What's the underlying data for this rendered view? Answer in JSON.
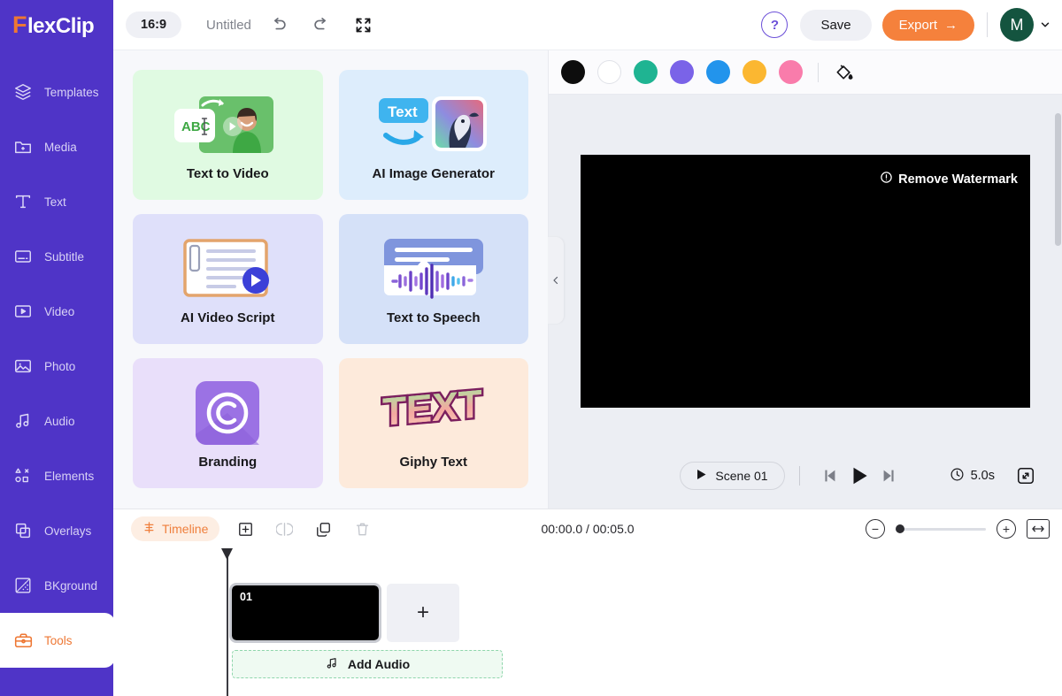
{
  "brand": {
    "prefix": "F",
    "rest": "lexClip"
  },
  "sidebar": {
    "items": [
      {
        "label": "Templates",
        "icon": "layers-icon",
        "active": false
      },
      {
        "label": "Media",
        "icon": "folder-plus-icon",
        "active": false
      },
      {
        "label": "Text",
        "icon": "text-t-icon",
        "active": false
      },
      {
        "label": "Subtitle",
        "icon": "subtitle-icon",
        "active": false
      },
      {
        "label": "Video",
        "icon": "video-play-icon",
        "active": false
      },
      {
        "label": "Photo",
        "icon": "photo-icon",
        "active": false
      },
      {
        "label": "Audio",
        "icon": "music-note-icon",
        "active": false
      },
      {
        "label": "Elements",
        "icon": "shapes-icon",
        "active": false
      },
      {
        "label": "Overlays",
        "icon": "overlays-icon",
        "active": false
      },
      {
        "label": "BKground",
        "icon": "background-icon",
        "active": false
      },
      {
        "label": "Tools",
        "icon": "toolbox-icon",
        "active": true
      }
    ]
  },
  "topbar": {
    "ratio": "16:9",
    "project_title": "Untitled",
    "undo_icon": "undo-icon",
    "redo_icon": "redo-icon",
    "fullscreen_icon": "expand-icon",
    "help_glyph": "?",
    "save_label": "Save",
    "export_label": "Export",
    "export_arrow": "→",
    "avatar_initial": "M"
  },
  "tools_panel": {
    "collapse_glyph": "‹",
    "cards": [
      {
        "label": "Text to Video",
        "bg": "#e0fae2",
        "art": "text-to-video-art"
      },
      {
        "label": "AI Image Generator",
        "bg": "#ddedfc",
        "art": "ai-image-generator-art"
      },
      {
        "label": "AI Video Script",
        "bg": "#dfe0fa",
        "art": "ai-video-script-art"
      },
      {
        "label": "Text to Speech",
        "bg": "#d5e1f8",
        "art": "text-to-speech-art"
      },
      {
        "label": "Branding",
        "bg": "#e9dffa",
        "art": "branding-art"
      },
      {
        "label": "Giphy Text",
        "bg": "#fdeadb",
        "art": "giphy-text-art"
      }
    ]
  },
  "swatches": {
    "colors": [
      "#0d0d0d",
      "#ffffff",
      "#1fb492",
      "#7a63e8",
      "#2294ec",
      "#fbb731",
      "#f97cab"
    ],
    "fill_icon": "paint-bucket-icon"
  },
  "canvas": {
    "watermark_label": "Remove Watermark",
    "watermark_icon": "info-circle-icon"
  },
  "player": {
    "scene_label": "Scene 01",
    "scene_play_icon": "play-icon",
    "prev_icon": "skip-previous-icon",
    "play_icon": "play-icon",
    "next_icon": "skip-next-icon",
    "clock_icon": "clock-icon",
    "duration": "5.0s",
    "fullscreen_icon": "fullscreen-expand-icon"
  },
  "timeline": {
    "tab_label": "Timeline",
    "tab_icon": "timeline-icon",
    "add_icon": "add-box-icon",
    "split_icon": "split-icon",
    "duplicate_icon": "duplicate-icon",
    "delete_icon": "trash-icon",
    "time_display": "00:00.0 / 00:05.0",
    "zoom_out_glyph": "−",
    "zoom_in_glyph": "+",
    "fit_icon": "fit-width-icon",
    "clip_number": "01",
    "add_scene_glyph": "+",
    "add_audio_label": "Add Audio",
    "add_audio_icon": "music-note-icon"
  }
}
